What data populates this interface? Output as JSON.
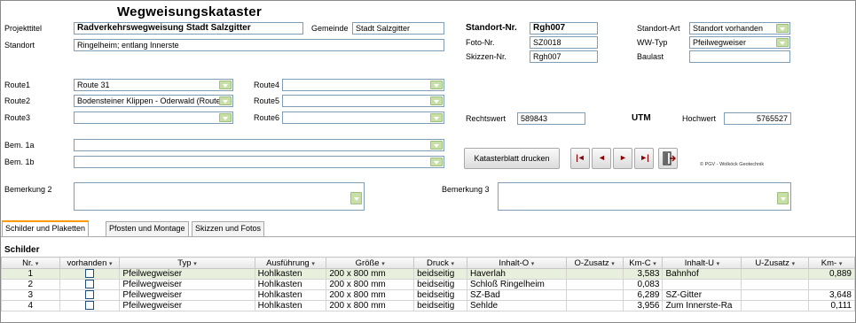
{
  "form_title": "Wegweisungskataster",
  "labels": {
    "projekttitel": "Projekttitel",
    "standort": "Standort",
    "gemeinde": "Gemeinde",
    "standort_nr": "Standort-Nr.",
    "foto_nr": "Foto-Nr.",
    "skizzen_nr": "Skizzen-Nr.",
    "standort_art": "Standort-Art",
    "ww_typ": "WW-Typ",
    "baulast": "Baulast",
    "route1": "Route1",
    "route2": "Route2",
    "route3": "Route3",
    "route4": "Route4",
    "route5": "Route5",
    "route6": "Route6",
    "rechtswert": "Rechtswert",
    "utm": "UTM",
    "hochwert": "Hochwert",
    "bem1a": "Bem. 1a",
    "bem1b": "Bem. 1b",
    "bemerkung2": "Bemerkung 2",
    "bemerkung3": "Bemerkung 3"
  },
  "fields": {
    "projekttitel": "Radverkehrswegweisung Stadt Salzgitter",
    "standort": "Ringelheim; entlang Innerste",
    "gemeinde": "Stadt Salzgitter",
    "standort_nr": "Rgh007",
    "foto_nr": "SZ0018",
    "skizzen_nr": "Rgh007",
    "standort_art": "Standort vorhanden",
    "ww_typ": "Pfeilwegweiser",
    "baulast": "",
    "route1": "Route 31",
    "route2": "Bodensteiner Klippen - Oderwald (Route",
    "route3": "",
    "route4": "",
    "route5": "",
    "route6": "",
    "rechtswert": "589843",
    "hochwert": "5765527",
    "bem1a": "",
    "bem1b": "",
    "bemerkung2": "",
    "bemerkung3": ""
  },
  "buttons": {
    "katasterblatt": "Katasterblatt drucken",
    "first": "|◄",
    "prev": "◄",
    "next": "►",
    "last": "►|",
    "exit_icon": "exit-icon"
  },
  "copyright": "© PGV - Wolköck Geotechnik",
  "tabs": [
    "Schilder und Plaketten",
    "Pfosten und Montage",
    "Skizzen und Fotos"
  ],
  "active_tab": 0,
  "subform_title": "Schilder",
  "grid": {
    "columns": [
      "Nr.",
      "vorhanden",
      "Typ",
      "Ausführung",
      "Größe",
      "Druck",
      "Inhalt-O",
      "O-Zusatz",
      "Km-C",
      "Inhalt-U",
      "U-Zusatz",
      "Km-"
    ],
    "rows": [
      {
        "nr": "1",
        "vorhanden": false,
        "typ": "Pfeilwegweiser",
        "ausf": "Hohlkasten",
        "groesse": "200 x 800 mm",
        "druck": "beidseitig",
        "inhalt_o": "Haverlah",
        "o_zusatz": "",
        "km_c": "3,583",
        "inhalt_u": "Bahnhof",
        "u_zusatz": "",
        "km": "0,889"
      },
      {
        "nr": "2",
        "vorhanden": false,
        "typ": "Pfeilwegweiser",
        "ausf": "Hohlkasten",
        "groesse": "200 x 800 mm",
        "druck": "beidseitig",
        "inhalt_o": "Schloß Ringelheim",
        "o_zusatz": "",
        "km_c": "0,083",
        "inhalt_u": "",
        "u_zusatz": "",
        "km": ""
      },
      {
        "nr": "3",
        "vorhanden": false,
        "typ": "Pfeilwegweiser",
        "ausf": "Hohlkasten",
        "groesse": "200 x 800 mm",
        "druck": "beidseitig",
        "inhalt_o": "SZ-Bad",
        "o_zusatz": "",
        "km_c": "6,289",
        "inhalt_u": "SZ-Gitter",
        "u_zusatz": "",
        "km": "3,648"
      },
      {
        "nr": "4",
        "vorhanden": false,
        "typ": "Pfeilwegweiser",
        "ausf": "Hohlkasten",
        "groesse": "200 x 800 mm",
        "druck": "beidseitig",
        "inhalt_o": "Sehlde",
        "o_zusatz": "",
        "km_c": "3,956",
        "inhalt_u": "Zum Innerste-Ra",
        "u_zusatz": "",
        "km": "0,111"
      }
    ]
  },
  "colors": {
    "field_border": "#7f9db9",
    "dropdown_button": "#c8e0a8",
    "active_tab_accent": "#ff9a00",
    "selected_row": "#e8efdc",
    "nav_arrow": "#8b0000"
  }
}
